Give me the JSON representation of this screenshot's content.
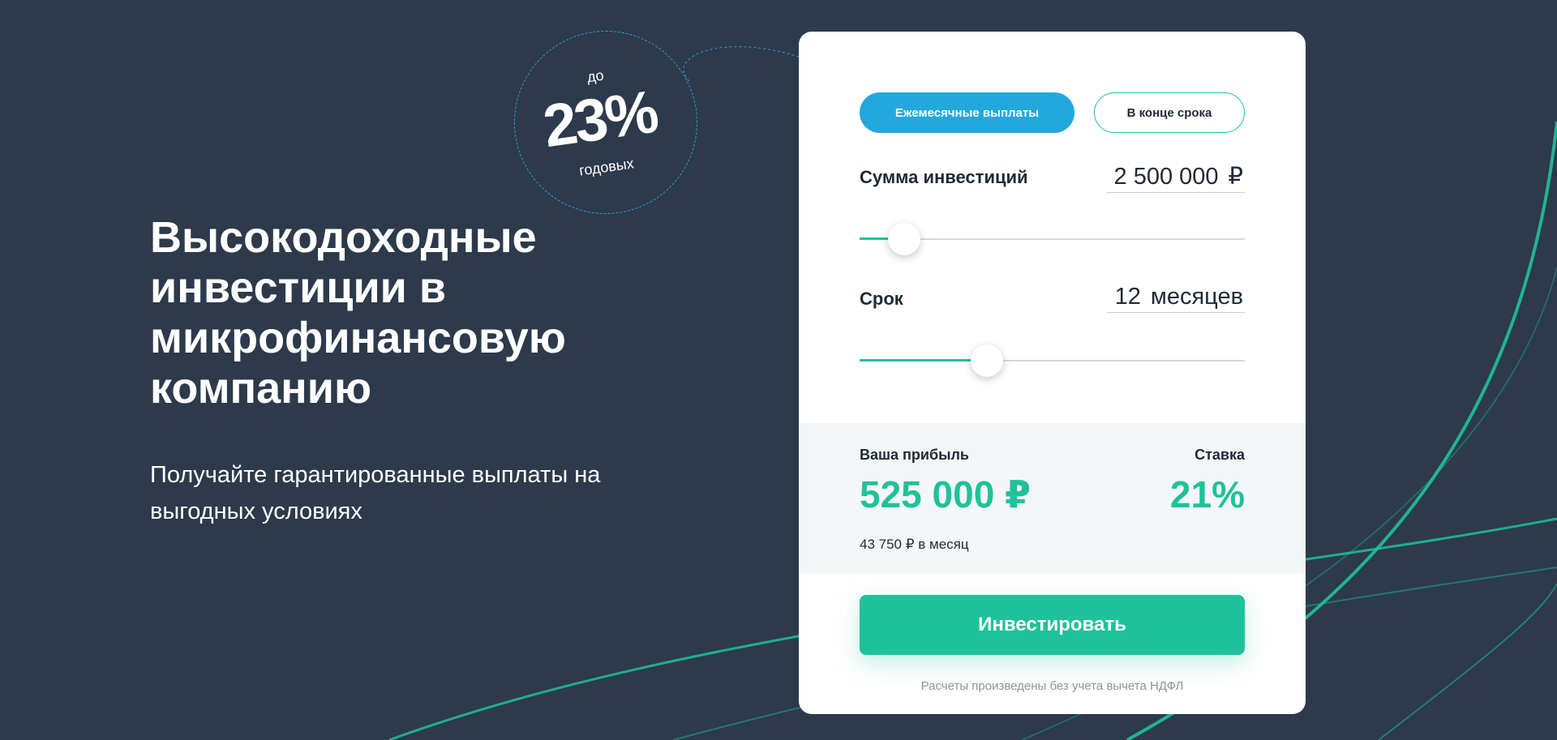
{
  "colors": {
    "background": "#2c3a4b",
    "accent_green": "#1fc29a",
    "accent_blue": "#22a8dd",
    "card": "#ffffff",
    "result_bg": "#f4f7f8"
  },
  "badge": {
    "prefix": "до",
    "value": "23%",
    "suffix": "годовых"
  },
  "hero": {
    "title": "Высокодоходные инвестиции в микрофинансовую компанию",
    "subtitle": "Получайте гарантированные выплаты на выгодных условиях"
  },
  "calculator": {
    "tabs": [
      {
        "label": "Ежемесячные выплаты",
        "active": true
      },
      {
        "label": "В конце срока",
        "active": false
      }
    ],
    "amount": {
      "label": "Сумма инвестиций",
      "value": "2 500 000",
      "unit": "₽",
      "slider_fraction": 0.115
    },
    "term": {
      "label": "Срок",
      "value": "12",
      "unit": "месяцев",
      "slider_fraction": 0.33
    },
    "result": {
      "profit_label": "Ваша прибыль",
      "profit_value": "525 000 ₽",
      "rate_label": "Ставка",
      "rate_value": "21%",
      "monthly": "43 750 ₽ в месяц"
    },
    "invest_button": "Инвестировать",
    "note": "Расчеты произведены без учета вычета НДФЛ"
  }
}
